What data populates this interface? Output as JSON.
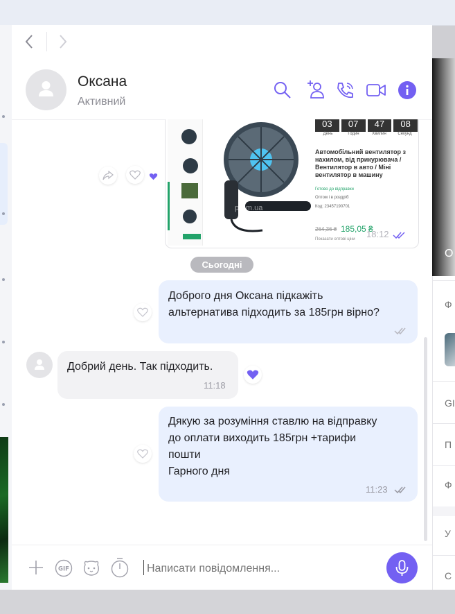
{
  "nav": {
    "back_icon": "chevron-left-icon",
    "forward_icon": "chevron-right-icon"
  },
  "contact": {
    "name": "Оксана",
    "status": "Активний"
  },
  "header_icons": [
    "search-icon",
    "add-participant-icon",
    "call-icon",
    "video-call-icon",
    "info-icon"
  ],
  "product_card": {
    "timer": [
      "03",
      "07",
      "47",
      "08"
    ],
    "timer_labels": [
      "День",
      "Годин",
      "Хвилин",
      "Секунд"
    ],
    "title": "Автомобільний вентилятор з нахилом, від прикурювача / Вентилятор в авто / Міні вентилятор в машину",
    "ready": "Готово до відправки",
    "wholesale": "Оптом і в роздріб",
    "code": "Код: 23457190701",
    "old_price": "264,36 ₴",
    "price": "185,05 ₴",
    "show_wholesale": "Показати оптові ціни",
    "watermark": "prom.ua",
    "time": "18:12"
  },
  "date_separator": "Сьогодні",
  "messages": [
    {
      "direction": "out",
      "text": "Доброго дня Оксана підкажіть\nальтернатива підходить за 185грн вірно?",
      "time": ""
    },
    {
      "direction": "in",
      "text": "Добрий  день. Так підходить.",
      "time": "11:18",
      "liked": true
    },
    {
      "direction": "out",
      "text": "Дякую за розуміння ставлю на відправку\nдо оплати виходить 185грн +тарифи\nпошти\nГарного дня",
      "time": "11:23"
    }
  ],
  "composer": {
    "placeholder": "Написати повідомлення..."
  },
  "right_panel": {
    "items": [
      "Ф",
      "GI",
      "П",
      "Ф",
      "У",
      "С"
    ],
    "overlay_letter": "O"
  },
  "colors": {
    "accent": "#7360f2",
    "bubble_out": "#e9f0fe",
    "bubble_in": "#f2f2f4"
  }
}
